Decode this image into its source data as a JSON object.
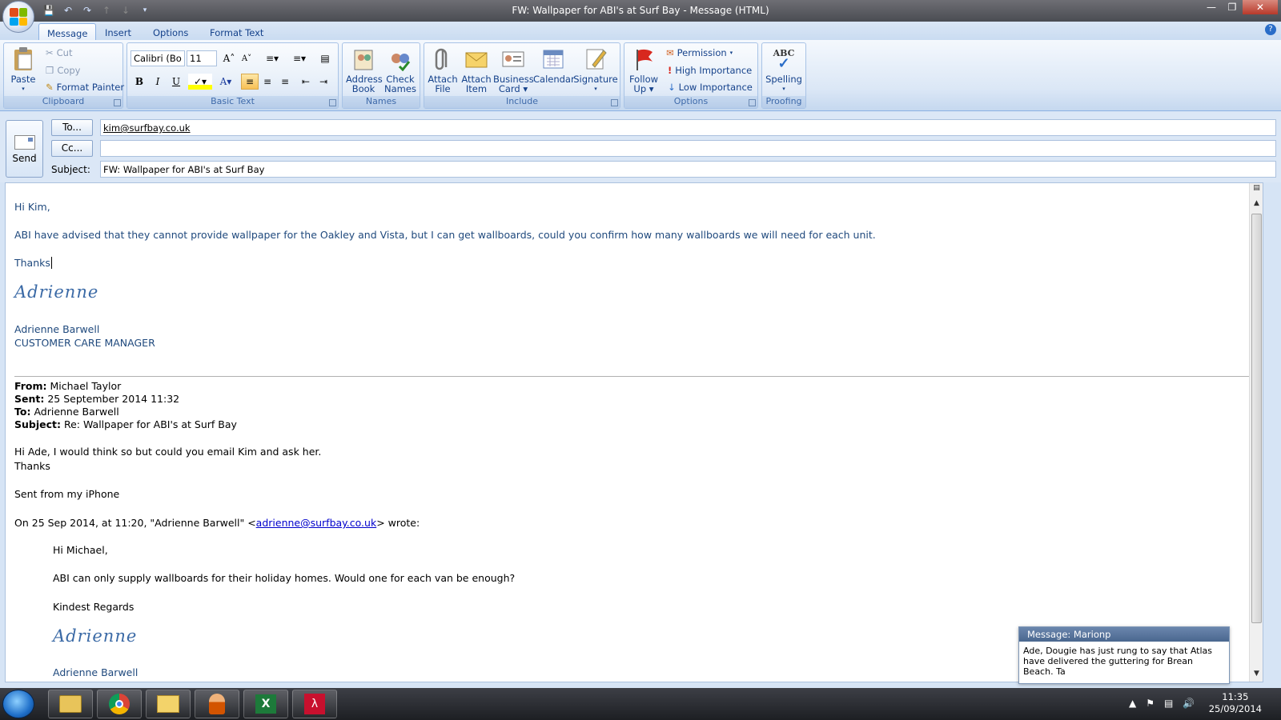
{
  "window": {
    "title": "FW: Wallpaper for ABI's at Surf Bay - Message (HTML)"
  },
  "tabs": [
    "Message",
    "Insert",
    "Options",
    "Format Text"
  ],
  "ribbon": {
    "clipboard": {
      "paste": "Paste",
      "cut": "Cut",
      "copy": "Copy",
      "format_painter": "Format Painter",
      "label": "Clipboard"
    },
    "basic_text": {
      "font": "Calibri (Bo",
      "size": "11",
      "bold": "B",
      "italic": "I",
      "underline": "U",
      "label": "Basic Text"
    },
    "names": {
      "address_book_1": "Address",
      "address_book_2": "Book",
      "check_names_1": "Check",
      "check_names_2": "Names",
      "label": "Names"
    },
    "include": {
      "attach_file_1": "Attach",
      "attach_file_2": "File",
      "attach_item_1": "Attach",
      "attach_item_2": "Item",
      "business_card_1": "Business",
      "business_card_2": "Card",
      "calendar": "Calendar",
      "signature": "Signature",
      "label": "Include"
    },
    "options": {
      "follow_up_1": "Follow",
      "follow_up_2": "Up",
      "permission": "Permission",
      "high_importance": "High Importance",
      "low_importance": "Low Importance",
      "label": "Options"
    },
    "proofing": {
      "spelling": "Spelling",
      "abc": "ABC",
      "label": "Proofing"
    }
  },
  "header": {
    "send": "Send",
    "to_button": "To...",
    "cc_button": "Cc...",
    "subject_label": "Subject:",
    "to_value": "kim@surfbay.co.uk",
    "cc_value": "",
    "subject_value": "FW: Wallpaper for ABI's at Surf Bay"
  },
  "body": {
    "greeting": "Hi Kim,",
    "message": "ABI have advised that they cannot provide wallpaper for the Oakley and Vista, but I can get wallboards, could you confirm how many wallboards we will need for each unit.",
    "thanks": "Thanks",
    "signature_script": "Adrienne",
    "sig_name": "Adrienne Barwell",
    "sig_title": "CUSTOMER CARE MANAGER",
    "fwd": {
      "from_label": "From:",
      "from": "Michael Taylor",
      "sent_label": "Sent:",
      "sent": "25 September 2014 11:32",
      "to_label": "To:",
      "to": "Adrienne Barwell",
      "subject_label": "Subject:",
      "subject": "Re: Wallpaper for ABI's at Surf Bay"
    },
    "reply_line1": "Hi Ade, I would think so but could you email Kim and ask her.",
    "reply_line2": "Thanks",
    "sent_from": "Sent from my iPhone",
    "wrote_prefix": "On 25 Sep 2014, at 11:20, \"Adrienne Barwell\" <",
    "wrote_email": "adrienne@surfbay.co.uk",
    "wrote_suffix": "> wrote:",
    "quoted_greeting": "Hi Michael,",
    "quoted_message": "ABI can only supply wallboards for their holiday homes.  Would one for each van be enough?",
    "quoted_regards": "Kindest Regards",
    "quoted_signature_script": "Adrienne",
    "quoted_sig_name": "Adrienne Barwell"
  },
  "notification": {
    "title": "Message: Marionp",
    "text": "Ade, Dougie has just rung to say that Atlas have delivered the guttering for Brean Beach. Ta"
  },
  "tray": {
    "time": "11:35",
    "date": "25/09/2014"
  },
  "colors": {
    "body_text": "#1f497d",
    "link": "#0000cc",
    "ribbon": "#dbe7f6"
  }
}
